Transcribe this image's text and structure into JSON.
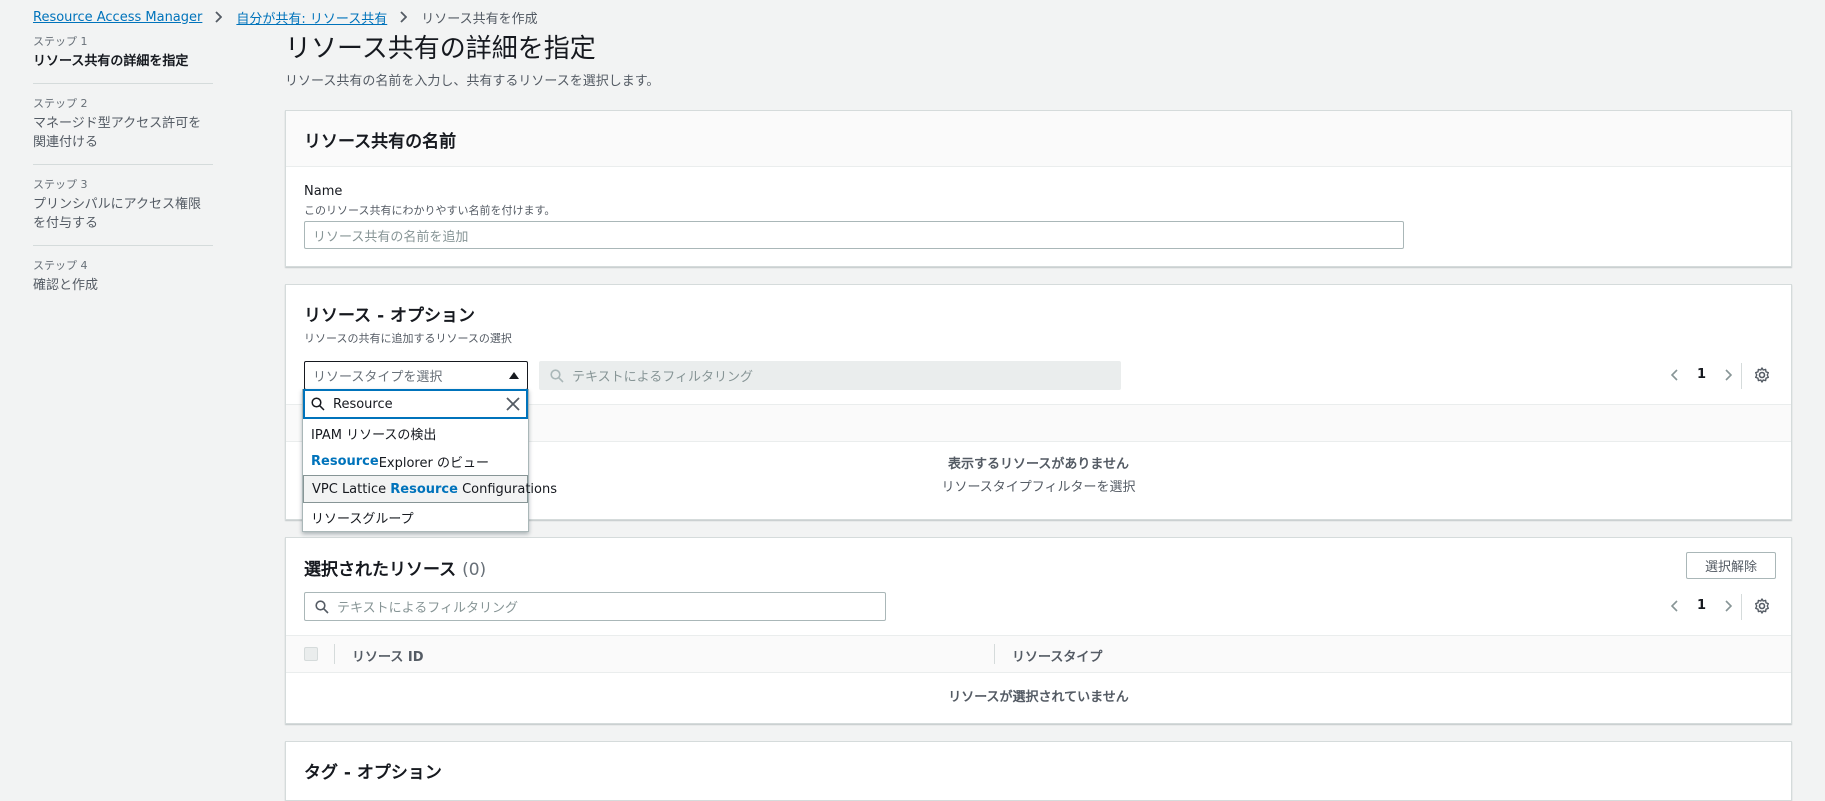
{
  "breadcrumb": {
    "items": [
      "Resource Access Manager",
      "自分が共有: リソース共有"
    ],
    "current": "リソース共有を作成"
  },
  "steps": [
    {
      "num": "ステップ 1",
      "label": "リソース共有の詳細を指定",
      "active": true
    },
    {
      "num": "ステップ 2",
      "label": "マネージド型アクセス許可を関連付ける"
    },
    {
      "num": "ステップ 3",
      "label": "プリンシパルにアクセス権限を付与する"
    },
    {
      "num": "ステップ 4",
      "label": "確認と作成"
    }
  ],
  "page": {
    "title": "リソース共有の詳細を指定",
    "subtitle": "リソース共有の名前を入力し、共有するリソースを選択します。"
  },
  "name_panel": {
    "title": "リソース共有の名前",
    "field_label": "Name",
    "field_desc": "このリソース共有にわかりやすい名前を付けます。",
    "placeholder": "リソース共有の名前を追加"
  },
  "resources_panel": {
    "title": "リソース - オプション",
    "desc": "リソースの共有に追加するリソースの選択",
    "type_select_placeholder": "リソースタイプを選択",
    "filter_placeholder": "テキストによるフィルタリング",
    "page": "1",
    "empty_title": "表示するリソースがありません",
    "empty_desc": "リソースタイプフィルターを選択"
  },
  "dropdown": {
    "search_value": "Resource",
    "options": [
      {
        "before": "IPAM リソースの検出",
        "match": "",
        "after": ""
      },
      {
        "before": "",
        "match": "Resource",
        "after": " Explorer のビュー"
      },
      {
        "before": "VPC Lattice ",
        "match": "Resource",
        "after": " Configurations"
      },
      {
        "before": "リソースグループ",
        "match": "",
        "after": ""
      }
    ]
  },
  "selected_panel": {
    "title": "選択されたリソース",
    "count": "(0)",
    "deselect_button": "選択解除",
    "filter_placeholder": "テキストによるフィルタリング",
    "page": "1",
    "columns": [
      "リソース ID",
      "リソースタイプ"
    ],
    "empty": "リソースが選択されていません"
  },
  "tags_panel": {
    "title": "タグ - オプション"
  },
  "colors": {
    "link": "#0073bb",
    "background": "#f2f3f3",
    "focus": "#0073bb"
  }
}
